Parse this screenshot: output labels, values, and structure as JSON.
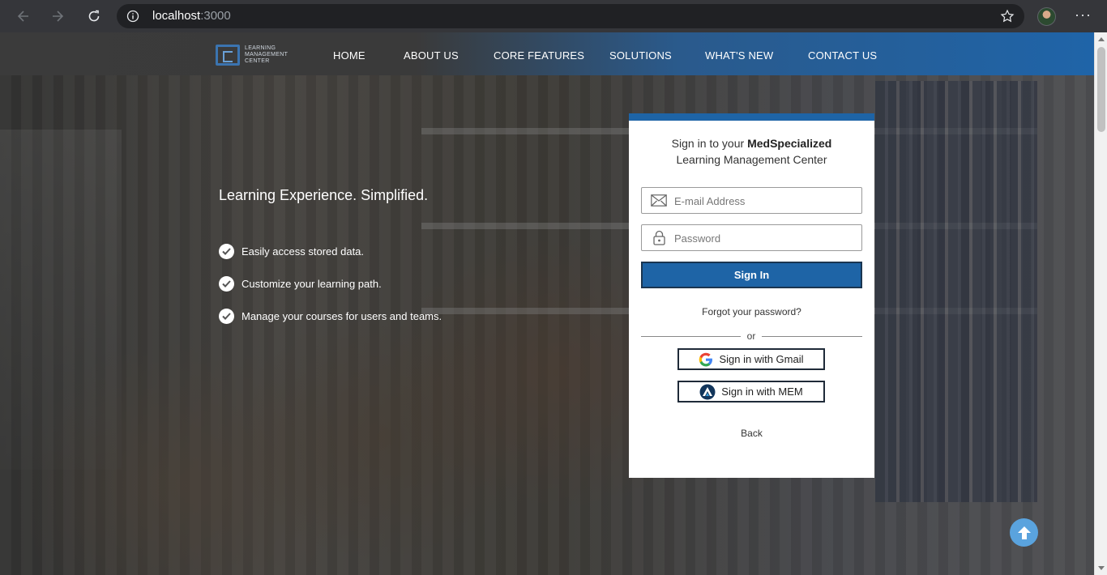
{
  "browser": {
    "url_host": "localhost",
    "url_port": ":3000"
  },
  "site": {
    "logo_lines": [
      "LEARNING",
      "MANAGEMENT",
      "CENTER"
    ],
    "nav": [
      "HOME",
      "ABOUT US",
      "CORE FEATURES",
      "SOLUTIONS",
      "WHAT'S NEW",
      "CONTACT US"
    ]
  },
  "hero": {
    "tagline": "Learning Experience. Simplified.",
    "features": [
      "Easily access stored data.",
      "Customize your learning path.",
      "Manage your courses for users and teams."
    ]
  },
  "login": {
    "title_prefix": "Sign in to your ",
    "title_brand": "MedSpecialized",
    "title_line2": "Learning Management Center",
    "email_placeholder": "E-mail Address",
    "password_placeholder": "Password",
    "signin_label": "Sign In",
    "forgot_label": "Forgot your password?",
    "or_label": "or",
    "gmail_label": "Sign in with Gmail",
    "mem_label": "Sign in with MEM",
    "back_label": "Back"
  },
  "colors": {
    "accent": "#1e64a6",
    "chrome": "#35363a",
    "scroll_top": "#5aa3de"
  }
}
